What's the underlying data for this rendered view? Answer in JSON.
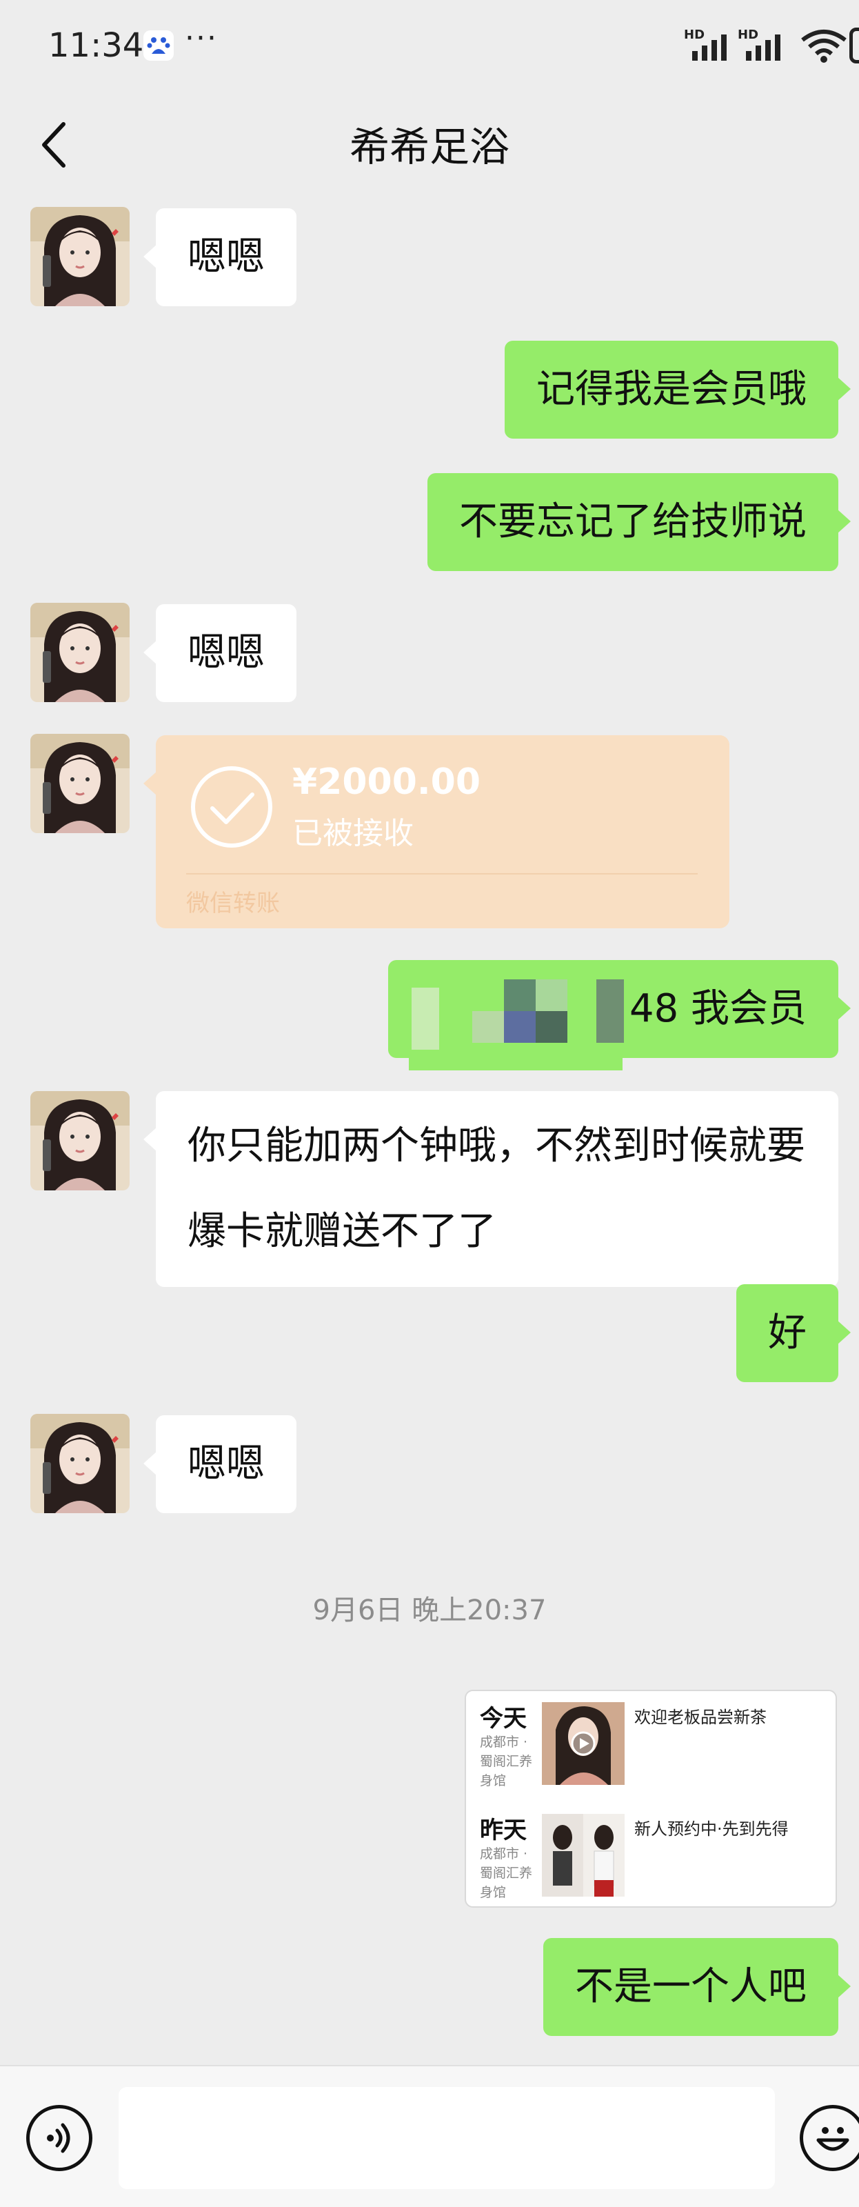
{
  "status_bar": {
    "time": "11:34",
    "more": "···",
    "signal_labels": [
      "HD",
      "HD"
    ]
  },
  "header": {
    "title": "希希足浴",
    "back_icon": "chevron-left-icon"
  },
  "messages": [
    {
      "direction": "in",
      "type": "text",
      "text": "嗯嗯"
    },
    {
      "direction": "out",
      "type": "text",
      "text": "记得我是会员哦"
    },
    {
      "direction": "out",
      "type": "text",
      "text": "不要忘记了给技师说"
    },
    {
      "direction": "in",
      "type": "text",
      "text": "嗯嗯"
    },
    {
      "direction": "in",
      "type": "transfer",
      "amount": "¥2000.00",
      "status": "已被接收",
      "source": "微信转账"
    },
    {
      "direction": "out",
      "type": "text",
      "text": "48 我会员",
      "redacted_prefix": true
    },
    {
      "direction": "in",
      "type": "text",
      "text": "你只能加两个钟哦，不然到时候就要爆卡就赠送不了了"
    },
    {
      "direction": "out",
      "type": "text",
      "text": "好"
    },
    {
      "direction": "in",
      "type": "text",
      "text": "嗯嗯"
    },
    {
      "direction": "system",
      "type": "timestamp",
      "text": "9月6日 晚上20:37"
    },
    {
      "direction": "out",
      "type": "moments",
      "rows": [
        {
          "day": "今天",
          "location": "成都市 · 蜀阁汇养身馆",
          "text": "欢迎老板品尝新茶"
        },
        {
          "day": "昨天",
          "location": "成都市 · 蜀阁汇养身馆",
          "text": "新人预约中·先到先得"
        }
      ]
    },
    {
      "direction": "out",
      "type": "text",
      "text": "不是一个人吧"
    }
  ],
  "input_bar": {
    "voice_icon": "voice-icon",
    "emoji_icon": "emoji-icon",
    "input_value": ""
  },
  "colors": {
    "background": "#ededed",
    "outgoing_bubble": "#95ec69",
    "incoming_bubble": "#ffffff",
    "transfer_card": "#f9dfc3",
    "timestamp": "#8c8c8c"
  }
}
